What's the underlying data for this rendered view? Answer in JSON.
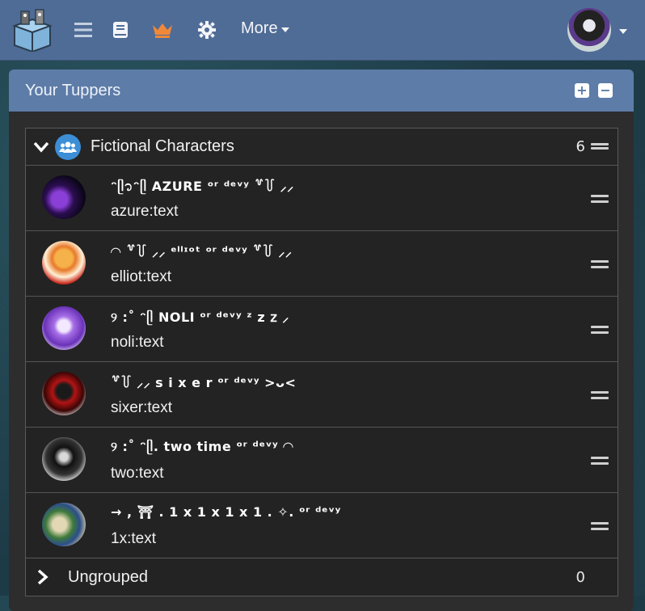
{
  "nav": {
    "more_label": "More"
  },
  "panel": {
    "title": "Your Tuppers"
  },
  "group": {
    "name": "Fictional Characters",
    "count": "6"
  },
  "tuppers": [
    {
      "name": "ᵔᥫ᭡ᵔᥫ AZURE  ᵒʳ  ᵈᵉᵛʸ  ꒷꒦ ⸝⸝",
      "brackets": "azure:text"
    },
    {
      "name": "◠ ꒷꒦ ⸝⸝ ᵉˡˡᶦᵒᵗ ᵒʳ ᵈᵉᵛʸ ꒷꒦ ⸝⸝",
      "brackets": "elliot:text"
    },
    {
      "name": "୨ :˚ ᵔᥫ NOLI  ᵒʳ  ᵈᵉᵛʸ  ᶻ z 𝗓 ⸝",
      "brackets": "noli:text"
    },
    {
      "name": "꒷꒦ ⸝⸝ s i x e r ᵒʳ ᵈᵉᵛʸ >ᴗ<",
      "brackets": "sixer:text"
    },
    {
      "name": "୨ :˚ ᵔᥫ. two time  ᵒʳ  ᵈᵉᵛʸ ◠",
      "brackets": "two:text"
    },
    {
      "name": "→ , ⛩ . 1 x 1 x 1 x 1 . ✧. ᵒʳ ᵈᵉᵛʸ",
      "brackets": "1x:text"
    }
  ],
  "ungrouped": {
    "name": "Ungrouped",
    "count": "0"
  },
  "colors": {
    "navbar": "#4f6c96",
    "panel_header": "#5d7ca8",
    "group_icon": "#3c8ed6",
    "crown": "#f0883a"
  }
}
